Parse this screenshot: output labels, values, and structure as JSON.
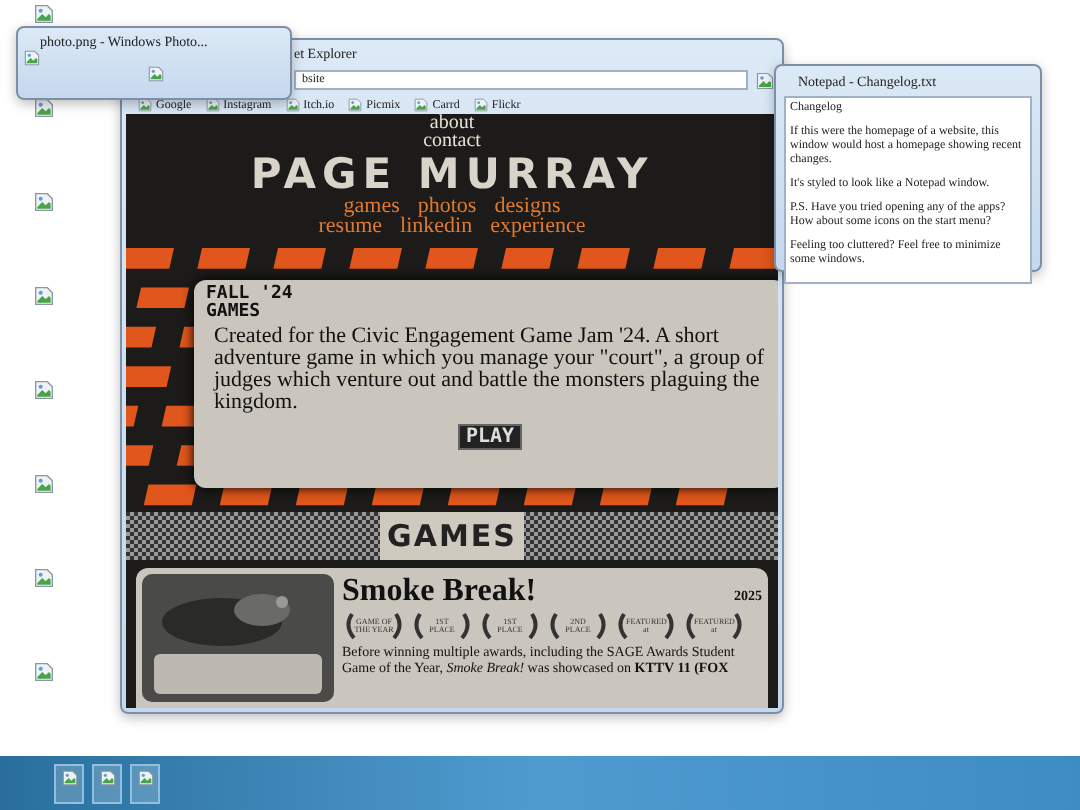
{
  "desktop_icons": [
    {
      "kind": "broken-image"
    },
    {
      "kind": "broken-image"
    },
    {
      "kind": "broken-image"
    },
    {
      "kind": "broken-image"
    },
    {
      "kind": "broken-image"
    },
    {
      "kind": "broken-image"
    },
    {
      "kind": "broken-image"
    },
    {
      "kind": "broken-image"
    }
  ],
  "browser": {
    "title": "et Explorer",
    "address": "bsite",
    "bookmarks": [
      "Google",
      "Instagram",
      "Itch.io",
      "Picmix",
      "Carrd",
      "Flickr"
    ],
    "page": {
      "top_links": [
        "about",
        "contact"
      ],
      "site_title": "PAGE MURRAY",
      "nav_rows": [
        [
          "games",
          "photos",
          "designs"
        ],
        [
          "resume",
          "linkedin",
          "experience"
        ]
      ],
      "feature": {
        "heading": [
          "FALL '24",
          "GAMES"
        ],
        "description": "Created for the Civic Engagement Game Jam '24. A short adventure game in which you manage your \"court\", a group of judges which venture out and battle the monsters plaguing the kingdom.",
        "button": "PLAY"
      },
      "section_title": "GAMES",
      "game": {
        "title": "Smoke Break!",
        "year": "2025",
        "awards": [
          "GAME OF THE YEAR",
          "1ST PLACE",
          "1ST PLACE",
          "2ND PLACE",
          "FEATURED at",
          "FEATURED at"
        ],
        "description": "Before winning multiple awards, including the SAGE Awards Student Game of the Year, *Smoke Break!* was showcased on **KTTV 11 (FOX**"
      }
    }
  },
  "photo_window": {
    "title": "photo.png - Windows Photo..."
  },
  "notepad": {
    "title": "Notepad - Changelog.txt",
    "paragraphs": [
      "Changelog",
      "If this were the homepage of a website, this window would host a homepage showing recent changes.",
      "It's styled to look like a Notepad window.",
      "P.S. Have you tried opening any of the apps? How about some icons on the start menu?",
      "Feeling too cluttered? Feel free to minimize some windows."
    ]
  },
  "taskbar": {
    "buttons": [
      {
        "kind": "broken-image"
      },
      {
        "kind": "broken-image"
      },
      {
        "kind": "broken-image"
      }
    ]
  }
}
